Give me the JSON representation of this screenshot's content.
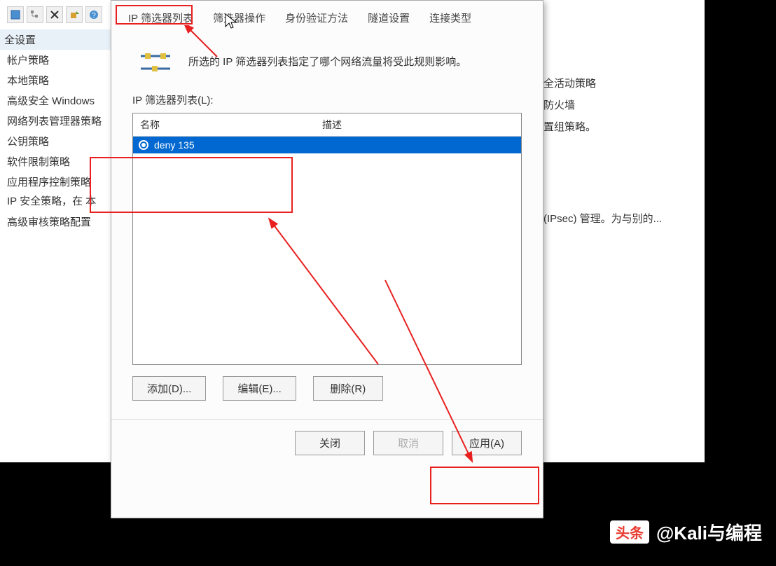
{
  "toolbar_icons": [
    "file-icon",
    "tree-icon",
    "close-icon",
    "export-icon",
    "help-icon"
  ],
  "sidebar": {
    "header": "全设置",
    "items": [
      "帐户策略",
      "本地策略",
      "高级安全 Windows",
      "网络列表管理器策略",
      "公钥策略",
      "软件限制策略",
      "应用程序控制策略",
      "IP 安全策略，在 本",
      "高级审核策略配置"
    ]
  },
  "dialog": {
    "tabs": [
      "IP 筛选器列表",
      "筛选器操作",
      "身份验证方法",
      "隧道设置",
      "连接类型"
    ],
    "active_tab": 0,
    "description": "所选的 IP 筛选器列表指定了哪个网络流量将受此规则影响。",
    "list_label": "IP 筛选器列表(L):",
    "columns": {
      "name": "名称",
      "desc": "描述"
    },
    "rows": [
      {
        "name": "deny 135",
        "desc": "",
        "selected": true
      }
    ],
    "buttons": {
      "add": "添加(D)...",
      "edit": "编辑(E)...",
      "remove": "删除(R)"
    },
    "bottom": {
      "close": "关闭",
      "cancel": "取消",
      "apply": "应用(A)"
    }
  },
  "right_panel": {
    "items": [
      "全活动策略",
      "防火墙",
      "置组策略。"
    ],
    "ipsec_text": "(IPsec) 管理。为与别的..."
  },
  "watermark": {
    "badge": "头条",
    "text": "@Kali与编程"
  }
}
